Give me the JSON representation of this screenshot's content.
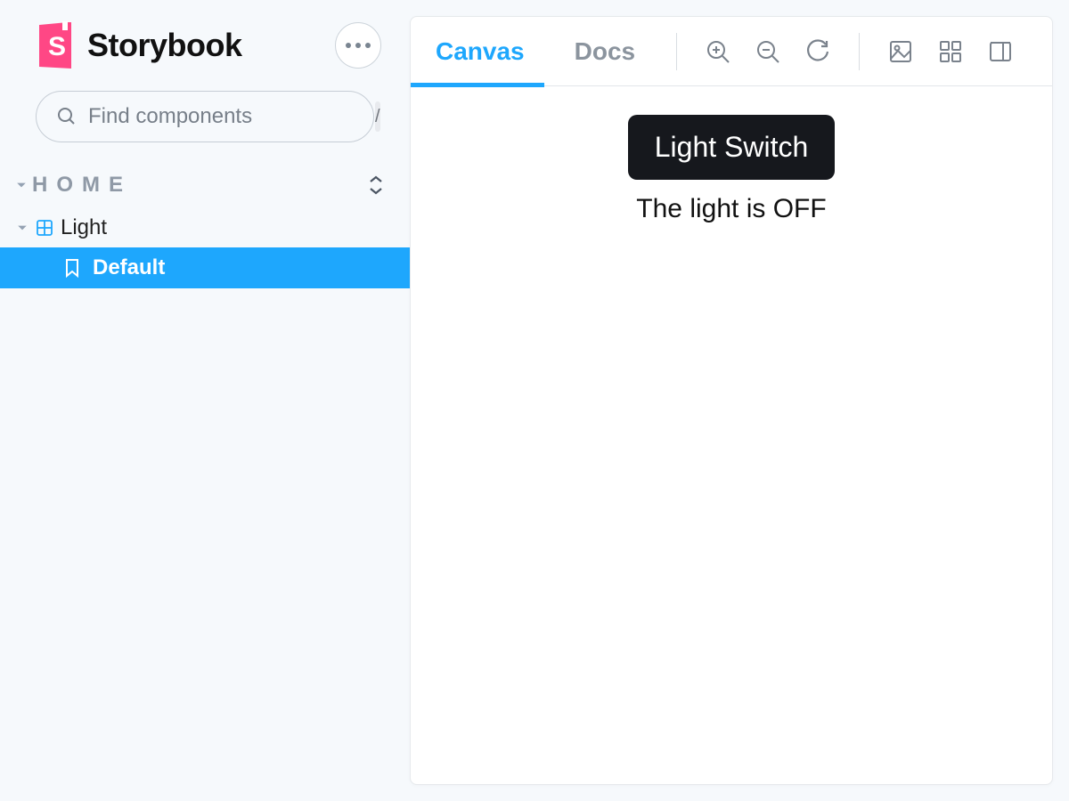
{
  "app": {
    "name": "Storybook"
  },
  "search": {
    "placeholder": "Find components",
    "shortcut": "/"
  },
  "sidebar": {
    "section": "HOME",
    "component": "Light",
    "story": "Default"
  },
  "tabs": {
    "canvas": "Canvas",
    "docs": "Docs",
    "active": "canvas"
  },
  "preview": {
    "button_label": "Light Switch",
    "status_text": "The light is OFF"
  },
  "colors": {
    "accent": "#1ea7fd"
  }
}
